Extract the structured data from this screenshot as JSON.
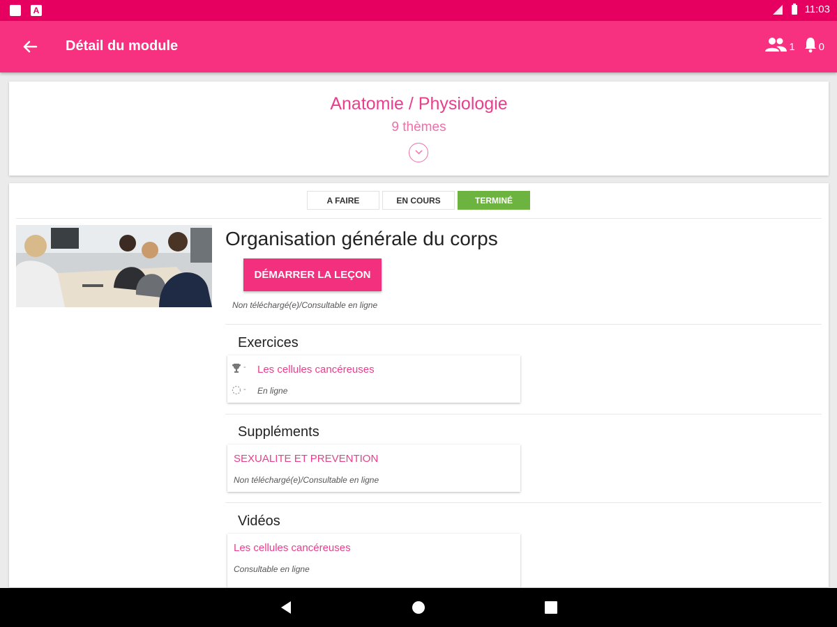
{
  "status_bar": {
    "time": "11:03"
  },
  "app_bar": {
    "title": "Détail du module",
    "users_count": "1",
    "notif_count": "0"
  },
  "module": {
    "title": "Anatomie / Physiologie",
    "subtitle": "9 thèmes"
  },
  "tabs": [
    {
      "label": "A FAIRE"
    },
    {
      "label": "EN COURS"
    },
    {
      "label": "TERMINÉ"
    }
  ],
  "lesson": {
    "title": "Organisation générale du corps",
    "start_button": "DÉMARRER LA LEÇON",
    "status": "Non téléchargé(e)/Consultable en ligne"
  },
  "exercises": {
    "title": "Exercices",
    "item_title": "Les cellules cancéreuses",
    "trophy_dash": "-",
    "progress_dash": "-",
    "item_status": "En ligne"
  },
  "supplements": {
    "title": "Suppléments",
    "item_title": "SEXUALITE ET PREVENTION",
    "item_status": "Non téléchargé(e)/Consultable en ligne"
  },
  "videos": {
    "title": "Vidéos",
    "item_title": "Les cellules cancéreuses",
    "item_status": "Consultable en ligne"
  },
  "colors": {
    "status_bar": "#e6005f",
    "app_bar": "#f7307f",
    "accent": "#e83e8c",
    "tab_active": "#6db33f"
  }
}
